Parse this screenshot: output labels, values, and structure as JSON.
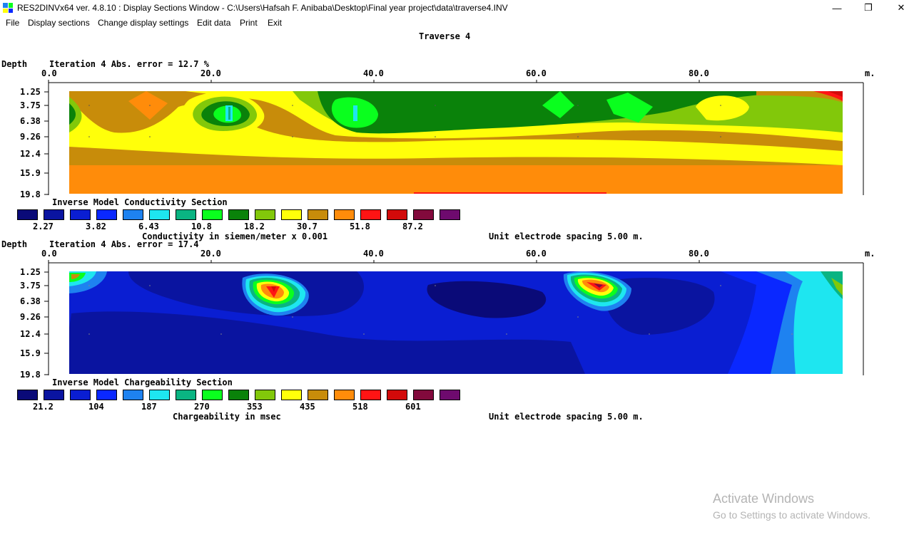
{
  "window": {
    "title": "RES2DINVx64 ver. 4.8.10 : Display Sections Window - C:\\Users\\Hafsah F. Anibaba\\Desktop\\Final year project\\data\\traverse4.INV",
    "minimize_glyph": "—",
    "maximize_glyph": "❐",
    "close_glyph": "✕"
  },
  "menu": [
    "File",
    "Display sections",
    "Change display settings",
    "Edit data",
    "Print",
    "Exit"
  ],
  "plot_title": "Traverse 4",
  "x_axis": {
    "unit": "m.",
    "ticks": [
      "0.0",
      "20.0",
      "40.0",
      "60.0",
      "80.0"
    ]
  },
  "depth_label": "Depth",
  "depth_ticks": [
    "1.25",
    "3.75",
    "6.38",
    "9.26",
    "12.4",
    "15.9",
    "19.8"
  ],
  "colors": {
    "scale": [
      "#0a0a78",
      "#0a14a0",
      "#0a1ed2",
      "#0a28ff",
      "#1e82f0",
      "#1ee6f0",
      "#0ab482",
      "#0aff1e",
      "#0a820a",
      "#82c80a",
      "#ffff0a",
      "#c88c0a",
      "#ff8c0a",
      "#ff1414",
      "#d20a0a",
      "#820a3c",
      "#6e0a6e"
    ]
  },
  "sections": [
    {
      "iteration_text": "Iteration 4 Abs. error = 12.7 %",
      "name": "Inverse Model Conductivity Section",
      "legend_values": [
        "2.27",
        "3.82",
        "6.43",
        "10.8",
        "18.2",
        "30.7",
        "51.8",
        "87.2"
      ],
      "units_text": "Conductivity in siemen/meter x 0.001",
      "spacing_text": "Unit electrode spacing 5.00 m."
    },
    {
      "iteration_text": "Iteration 4 Abs. error = 17.4",
      "name": "Inverse Model Chargeability Section",
      "legend_values": [
        "21.2",
        "104",
        "187",
        "270",
        "353",
        "435",
        "518",
        "601"
      ],
      "units_text": "Chargeability in msec",
      "spacing_text": "Unit electrode spacing 5.00 m."
    }
  ],
  "watermark": {
    "line1": "Activate Windows",
    "line2": "Go to Settings to activate Windows."
  }
}
